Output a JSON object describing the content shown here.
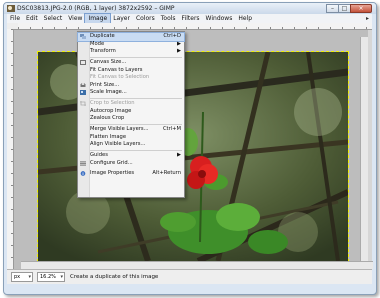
{
  "window": {
    "title": "DSC03813.JPG-2.0 (RGB, 1 layer) 3872x2592 – GIMP"
  },
  "menubar": {
    "items": [
      "File",
      "Edit",
      "Select",
      "View",
      "Image",
      "Layer",
      "Colors",
      "Tools",
      "Filters",
      "Windows",
      "Help"
    ],
    "active": "Image"
  },
  "image_menu": {
    "items": [
      {
        "label": "Duplicate",
        "shortcut": "Ctrl+D",
        "icon": "duplicate-icon",
        "highlighted": true
      },
      {
        "label": "Mode",
        "submenu": true
      },
      {
        "label": "Transform",
        "submenu": true
      },
      {
        "separator": true
      },
      {
        "label": "Canvas Size...",
        "icon": "canvas-size-icon"
      },
      {
        "label": "Fit Canvas to Layers"
      },
      {
        "label": "Fit Canvas to Selection",
        "disabled": true
      },
      {
        "label": "Print Size...",
        "icon": "print-size-icon"
      },
      {
        "label": "Scale Image...",
        "icon": "scale-image-icon"
      },
      {
        "separator": true
      },
      {
        "label": "Crop to Selection",
        "icon": "crop-icon",
        "disabled": true
      },
      {
        "label": "Autocrop Image"
      },
      {
        "label": "Zealous Crop"
      },
      {
        "separator": true
      },
      {
        "label": "Merge Visible Layers...",
        "shortcut": "Ctrl+M"
      },
      {
        "label": "Flatten Image"
      },
      {
        "label": "Align Visible Layers..."
      },
      {
        "separator": true
      },
      {
        "label": "Guides",
        "submenu": true
      },
      {
        "label": "Configure Grid...",
        "icon": "grid-icon"
      },
      {
        "label": "Image Properties",
        "shortcut": "Alt+Return",
        "icon": "info-icon"
      }
    ]
  },
  "statusbar": {
    "unit": "px",
    "zoom": "16.2%",
    "message": "Create a duplicate of this image"
  },
  "colors": {
    "menu_highlight": "#c9dcf3",
    "selection_outline": "#f0f000",
    "title_gradient_top": "#e9f0f8"
  }
}
